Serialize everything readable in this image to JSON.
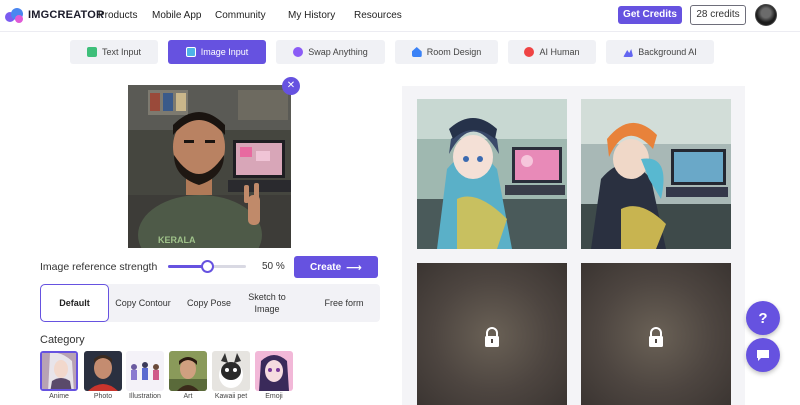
{
  "header": {
    "brand": "IMGCREATOR",
    "nav": [
      "Products",
      "Mobile App",
      "Community",
      "My History",
      "Resources"
    ],
    "get_credits_label": "Get Credits",
    "credits_label": "28 credits"
  },
  "tabs": [
    {
      "label": "Text Input",
      "icon": "text-input-icon",
      "active": false,
      "color": "#3ebf7a"
    },
    {
      "label": "Image Input",
      "icon": "image-input-icon",
      "active": true,
      "color": "#4fb3e8"
    },
    {
      "label": "Swap Anything",
      "icon": "swap-icon",
      "active": false,
      "color": "#8b5cf6"
    },
    {
      "label": "Room Design",
      "icon": "room-icon",
      "active": false,
      "color": "#3b82f6"
    },
    {
      "label": "AI Human",
      "icon": "human-icon",
      "active": false,
      "color": "#ef4444"
    },
    {
      "label": "Background AI",
      "icon": "background-icon",
      "active": false,
      "color": "#6366f1"
    }
  ],
  "editor": {
    "strength_label": "Image reference strength",
    "strength_value": "50 %",
    "strength_fraction": 0.5,
    "create_label": "Create",
    "modes": [
      "Default",
      "Copy Contour",
      "Copy Pose",
      "Sketch to Image",
      "Free form"
    ],
    "category_label": "Category",
    "categories": [
      "Anime",
      "Photo",
      "Illustration",
      "Art",
      "Kawaii pet",
      "Emoji"
    ]
  },
  "results": {
    "unlocked_count": 2,
    "locked_count": 2
  },
  "floating": {
    "help_icon": "question-icon",
    "chat_icon": "chat-icon"
  },
  "colors": {
    "accent": "#6652e0"
  }
}
